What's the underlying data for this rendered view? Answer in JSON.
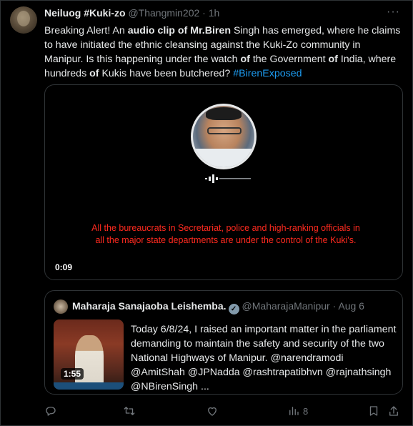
{
  "tweet": {
    "author_name": "Neiluog #Kuki-zo",
    "author_handle": "@Thangmin202",
    "separator": "·",
    "time": "1h",
    "more_icon": "more-icon",
    "text_parts": {
      "p1": "Breaking Alert! An ",
      "p2": "audio clip of Mr.Biren",
      "p3": " Singh has emerged, where he claims to have initiated the ethnic cleansing against the Kuki-Zo community in Manipur. Is this happening under the watch ",
      "p4": "of",
      "p5": " the Government ",
      "p6": "of",
      "p7": " India, where hundreds ",
      "p8": "of",
      "p9": " Kukis have been butchered? ",
      "hashtag": "#BirenExposed"
    }
  },
  "media": {
    "caption": "All the bureaucrats in Secretariat, police and high-ranking officials in all the major state departments are under the control of the Kuki's.",
    "caption_color": "#ff2a1f",
    "timestamp": "0:09"
  },
  "quote": {
    "author_name": "Maharaja Sanajaoba Leishemba.",
    "verified_icon": "verified-badge-icon",
    "author_handle": "@MaharajaManipur",
    "separator": "·",
    "date": "Aug 6",
    "video_duration": "1:55",
    "text": "Today 6/8/24, I raised an important matter in the parliament demanding to maintain the safety and security of the two National Highways of Manipur. @narendramodi @AmitShah @JPNadda @rashtrapatibhvn @rajnathsingh @NBirenSingh ..."
  },
  "actions": {
    "reply_icon": "reply-icon",
    "retweet_icon": "retweet-icon",
    "like_icon": "like-icon",
    "views_icon": "views-icon",
    "views_count": "8",
    "bookmark_icon": "bookmark-icon",
    "share_icon": "share-icon"
  },
  "colors": {
    "background": "#000000",
    "text": "#e7e9ea",
    "muted": "#71767b",
    "link": "#1d9bf0",
    "border": "#2f3336"
  }
}
